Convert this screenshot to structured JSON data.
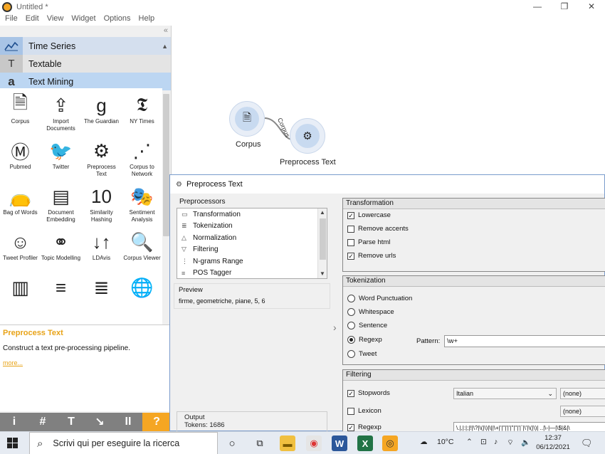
{
  "window": {
    "title": "Untitled *",
    "controls": {
      "minimize": "—",
      "maximize": "❐",
      "close": "✕"
    }
  },
  "menu": [
    "File",
    "Edit",
    "View",
    "Widget",
    "Options",
    "Help"
  ],
  "left_panel": {
    "collapse": "«",
    "categories": [
      {
        "label": "Time Series",
        "icon": "chart-line-icon"
      },
      {
        "label": "Textable",
        "icon": "text-cursor-icon"
      },
      {
        "label": "Text Mining",
        "icon": "letter-a-icon"
      }
    ],
    "widgets": [
      {
        "label": "Corpus",
        "icon": "document-a-icon"
      },
      {
        "label": "Import Documents",
        "icon": "import-documents-icon"
      },
      {
        "label": "The Guardian",
        "icon": "guardian-g-icon"
      },
      {
        "label": "NY Times",
        "icon": "nytimes-t-icon"
      },
      {
        "label": "Pubmed",
        "icon": "pubmed-icon"
      },
      {
        "label": "Twitter",
        "icon": "twitter-bird-icon"
      },
      {
        "label": "Preprocess Text",
        "icon": "gears-icon"
      },
      {
        "label": "Corpus to Network",
        "icon": "network-icon"
      },
      {
        "label": "Bag of Words",
        "icon": "bag-icon"
      },
      {
        "label": "Document Embedding",
        "icon": "embedding-icon"
      },
      {
        "label": "Similarity Hashing",
        "icon": "binary-icon"
      },
      {
        "label": "Sentiment Analysis",
        "icon": "masks-icon"
      },
      {
        "label": "Tweet Profiler",
        "icon": "smiley-icon"
      },
      {
        "label": "Topic Modelling",
        "icon": "topic-icon"
      },
      {
        "label": "LDAvis",
        "icon": "ldavis-icon"
      },
      {
        "label": "Corpus Viewer",
        "icon": "magnifier-doc-icon"
      },
      {
        "label": "",
        "icon": "bar-chart-icon"
      },
      {
        "label": "",
        "icon": "lines-icon"
      },
      {
        "label": "",
        "icon": "to-be-icon"
      },
      {
        "label": "",
        "icon": "globe-icon"
      }
    ],
    "icon_glyphs": {
      "document-a-icon": "🗎",
      "import-documents-icon": "⇪",
      "guardian-g-icon": "g",
      "nytimes-t-icon": "𝕿",
      "pubmed-icon": "Ⓜ",
      "twitter-bird-icon": "🐦",
      "gears-icon": "⚙",
      "network-icon": "⋰",
      "bag-icon": "👝",
      "embedding-icon": "▤",
      "binary-icon": "10",
      "masks-icon": "🎭",
      "smiley-icon": "☺",
      "topic-icon": "⚭",
      "ldavis-icon": "↓↑",
      "magnifier-doc-icon": "🔍",
      "bar-chart-icon": "▥",
      "lines-icon": "≡",
      "to-be-icon": "≣",
      "globe-icon": "🌐"
    },
    "description": {
      "title": "Preprocess Text",
      "text": "Construct a text pre-processing pipeline.",
      "more": "more..."
    },
    "toolbar": [
      "i",
      "#",
      "T",
      "↘",
      "II",
      "?"
    ]
  },
  "canvas": {
    "nodes": [
      {
        "label": "Corpus",
        "glyph": "🗎"
      },
      {
        "label": "Preprocess Text",
        "glyph": "⚙"
      }
    ],
    "link_label": "Corpus"
  },
  "dialog": {
    "title": "Preprocess Text",
    "preprocessors_label": "Preprocessors",
    "preprocessors": [
      {
        "label": "Transformation",
        "icon": "▭"
      },
      {
        "label": "Tokenization",
        "icon": "≣"
      },
      {
        "label": "Normalization",
        "icon": "△"
      },
      {
        "label": "Filtering",
        "icon": "▽"
      },
      {
        "label": "N-grams Range",
        "icon": "⋮"
      },
      {
        "label": "POS Tagger",
        "icon": "≡"
      }
    ],
    "preview": {
      "label": "Preview",
      "text": "firme, geometriche, piane, 5, 6"
    },
    "output": {
      "label": "Output",
      "tokens": "Tokens: 1686"
    },
    "transformation": {
      "title": "Transformation",
      "options": [
        {
          "label": "Lowercase",
          "checked": true
        },
        {
          "label": "Remove accents",
          "checked": false
        },
        {
          "label": "Parse html",
          "checked": false
        },
        {
          "label": "Remove urls",
          "checked": true
        }
      ]
    },
    "tokenization": {
      "title": "Tokenization",
      "options": [
        {
          "label": "Word  Punctuation",
          "selected": false
        },
        {
          "label": "Whitespace",
          "selected": false
        },
        {
          "label": "Sentence",
          "selected": false
        },
        {
          "label": "Regexp",
          "selected": true
        },
        {
          "label": "Tweet",
          "selected": false
        }
      ],
      "pattern_label": "Pattern:",
      "pattern_value": "\\w+"
    },
    "filtering": {
      "title": "Filtering",
      "stopwords": {
        "label": "Stopwords",
        "checked": true,
        "language": "Italian",
        "file": "(none)"
      },
      "lexicon": {
        "label": "Lexicon",
        "checked": false,
        "file": "(none)"
      },
      "regexp": {
        "label": "Regexp",
        "checked": true,
        "value": "\\.|,|:|;|!|\\?|\\(|\\)|\\||\\+|'|\"|'|'|\"|\"|'|`|\\'|\\(|\\)|  ..|\\-|—|\\$|&|\\"
      }
    }
  },
  "taskbar": {
    "search_placeholder": "Scrivi qui per eseguire la ricerca",
    "weather": "10°C",
    "time": "12:37",
    "date": "06/12/2021"
  },
  "colors": {
    "accent_orange": "#f5a623",
    "category_blue": "#bcd6f2",
    "node_fill": "#c8daf0",
    "dialog_border": "#7a9ccc"
  }
}
